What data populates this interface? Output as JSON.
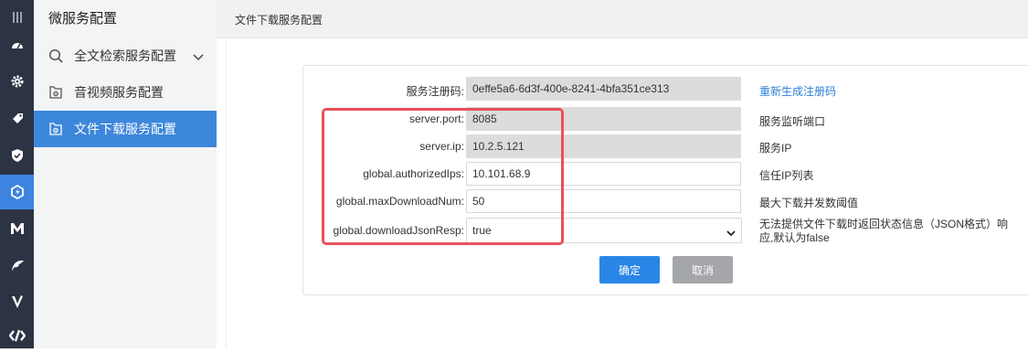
{
  "rail": {
    "icons": [
      "menu-icon",
      "dashboard-icon",
      "gear-icon",
      "tag-icon",
      "shield-check-icon",
      "service-icon",
      "m-logo-icon",
      "leaf-icon",
      "v-logo-icon",
      "code-icon"
    ],
    "active_index": 5
  },
  "sidebar": {
    "title": "微服务配置",
    "items": [
      {
        "label": "全文检索服务配置",
        "icon": "search-icon",
        "expandable": true
      },
      {
        "label": "音视频服务配置",
        "icon": "media-config-icon"
      },
      {
        "label": "文件下载服务配置",
        "icon": "media-config-icon",
        "active": true
      }
    ]
  },
  "header": {
    "breadcrumb": "文件下载服务配置"
  },
  "form": {
    "rows": [
      {
        "label": "服务注册码",
        "value": "0effe5a6-6d3f-400e-8241-4bfa351ce313",
        "readonly": true,
        "desc": "",
        "link": "重新生成注册码"
      },
      {
        "label": "server.port",
        "value": "8085",
        "readonly": true,
        "desc": "服务监听端口"
      },
      {
        "label": "server.ip",
        "value": "10.2.5.121",
        "readonly": true,
        "desc": "服务IP"
      },
      {
        "label": "global.authorizedIps",
        "value": "10.101.68.9",
        "readonly": false,
        "desc": "信任IP列表"
      },
      {
        "label": "global.maxDownloadNum",
        "value": "50",
        "readonly": false,
        "desc": "最大下载并发数阈值"
      },
      {
        "label": "global.downloadJsonResp",
        "value": "true",
        "readonly": false,
        "type": "select",
        "desc_line1": "无法提供文件下载时返回状态信息（JSON格式）响",
        "desc_line2": "应,默认为false"
      }
    ],
    "label_suffix": ":",
    "confirm_label": "确定",
    "cancel_label": "取消"
  },
  "colors": {
    "accent": "#3d87db",
    "rail_bg": "#2c3343",
    "highlight": "#e8505b",
    "link": "#2d7fd6"
  }
}
